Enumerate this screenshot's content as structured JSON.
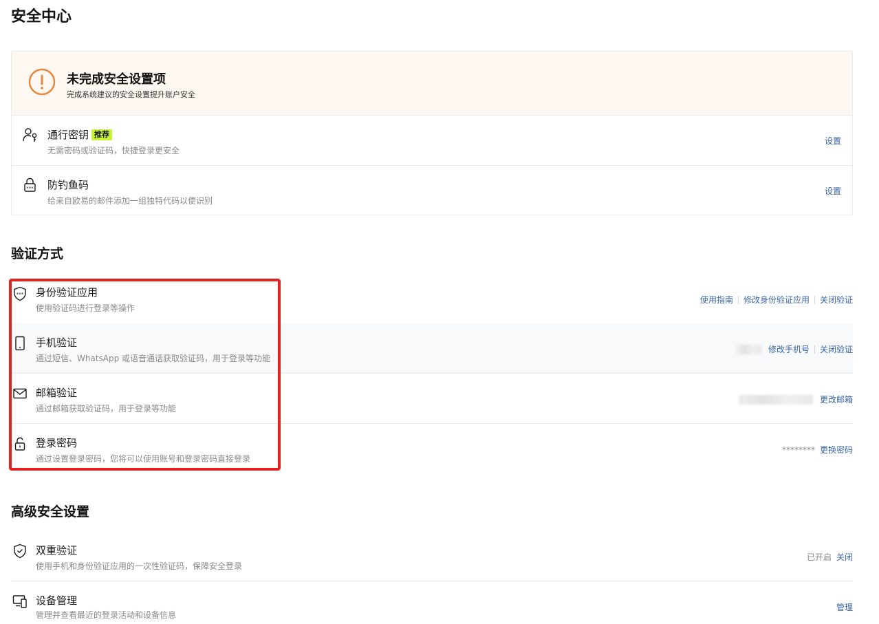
{
  "page_title": "安全中心",
  "incomplete": {
    "title": "未完成安全设置项",
    "subtitle": "完成系统建议的安全设置提升账户安全",
    "items": [
      {
        "icon": "passkey-icon",
        "title": "通行密钥",
        "badge": "推荐",
        "desc": "无需密码或验证码，快捷登录更安全",
        "action": "设置"
      },
      {
        "icon": "anti-phishing-icon",
        "title": "防钓鱼码",
        "desc": "给来自欧易的邮件添加一组独特代码以便识别",
        "action": "设置"
      }
    ]
  },
  "verification": {
    "title": "验证方式",
    "items": [
      {
        "icon": "authenticator-shield-icon",
        "title": "身份验证应用",
        "desc": "使用验证码进行登录等操作",
        "actions": [
          "使用指南",
          "修改身份验证应用",
          "关闭验证"
        ]
      },
      {
        "icon": "phone-icon",
        "title": "手机验证",
        "desc": "通过短信、WhatsApp 或语音通话获取验证码，用于登录等功能",
        "actions": [
          "修改手机号",
          "关闭验证"
        ]
      },
      {
        "icon": "mail-icon",
        "title": "邮箱验证",
        "desc": "通过邮箱获取验证码，用于登录等功能",
        "actions": [
          "更改邮箱"
        ]
      },
      {
        "icon": "lock-icon",
        "title": "登录密码",
        "desc": "通过设置登录密码，您将可以使用账号和登录密码直接登录",
        "masked_value": "********",
        "actions": [
          "更换密码"
        ]
      }
    ]
  },
  "advanced": {
    "title": "高级安全设置",
    "items": [
      {
        "icon": "shield-check-icon",
        "title": "双重验证",
        "desc": "使用手机和身份验证应用的一次性验证码，保障安全登录",
        "status": "已开启",
        "actions": [
          "关闭"
        ]
      },
      {
        "icon": "devices-icon",
        "title": "设备管理",
        "desc": "管理并查看最近的登录活动和设备信息",
        "actions": [
          "管理"
        ]
      }
    ]
  },
  "colors": {
    "link": "#3a67a8",
    "warning": "#e8863a",
    "badge": "#c6f432",
    "highlight": "#e3201b"
  }
}
